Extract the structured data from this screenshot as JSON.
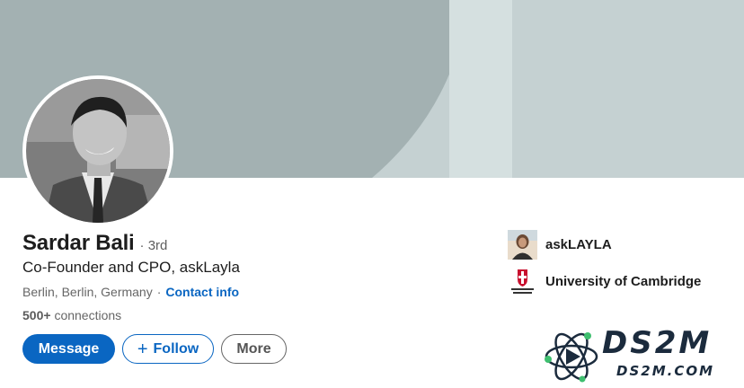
{
  "profile": {
    "name": "Sardar Bali",
    "degree": "· 3rd",
    "headline": "Co-Founder and CPO, askLayla",
    "location": "Berlin, Berlin, Germany",
    "separator": "·",
    "contact_info": "Contact info",
    "connections_count": "500+",
    "connections_label": "connections"
  },
  "actions": {
    "message": "Message",
    "follow": "Follow",
    "follow_icon": "+",
    "more": "More"
  },
  "sidebar": {
    "company": "askLAYLA",
    "education": "University of Cambridge"
  },
  "watermark": {
    "brand": "DS2M",
    "url": "DS2M.COM"
  },
  "colors": {
    "accent": "#0a66c2",
    "banner": "#c5d1d2",
    "banner_arc": "#a3b1b2"
  },
  "icons": {
    "avatar": "profile-photo",
    "company_logo": "asklayla-logo",
    "school_logo": "cambridge-crest",
    "watermark_logo": "ds2m-atom-logo"
  }
}
